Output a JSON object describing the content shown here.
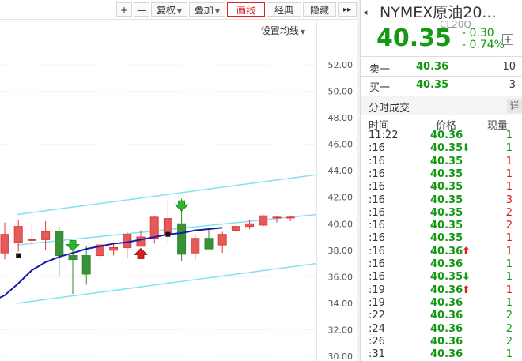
{
  "toolbar": {
    "zoom_in": "+",
    "zoom_out": "—",
    "adjust": "复权",
    "overlay": "叠加",
    "draw_line": "画线",
    "classic": "经典",
    "hide": "隐藏",
    "more": "▸▸"
  },
  "chart": {
    "ma_setting_label": "设置均线",
    "y_ticks": [
      "52.00",
      "50.00",
      "48.00",
      "46.00",
      "44.00",
      "42.00",
      "40.00",
      "38.00",
      "36.00",
      "34.00",
      "32.00",
      "30.00"
    ],
    "colors": {
      "up": "#e23a3a",
      "down": "#2e8b2e",
      "ma": "#1a1aa8",
      "channel": "#7fe3f0"
    }
  },
  "chart_data": {
    "type": "candlestick",
    "ylim": [
      30,
      52
    ],
    "y_tick_values": [
      52,
      50,
      48,
      46,
      44,
      42,
      40,
      38,
      36,
      34,
      32,
      30
    ],
    "candles": [
      {
        "o": 37.8,
        "h": 40.1,
        "l": 37.3,
        "c": 39.2
      },
      {
        "o": 38.6,
        "h": 40.3,
        "l": 37.9,
        "c": 39.8
      },
      {
        "o": 38.8,
        "h": 40.0,
        "l": 38.2,
        "c": 38.8
      },
      {
        "o": 38.8,
        "h": 40.2,
        "l": 38.0,
        "c": 39.4
      },
      {
        "o": 39.4,
        "h": 39.8,
        "l": 36.1,
        "c": 37.6
      },
      {
        "o": 37.6,
        "h": 38.1,
        "l": 34.7,
        "c": 37.3
      },
      {
        "o": 37.6,
        "h": 38.3,
        "l": 35.4,
        "c": 36.2
      },
      {
        "o": 37.6,
        "h": 39.1,
        "l": 37.2,
        "c": 38.4
      },
      {
        "o": 38.0,
        "h": 38.6,
        "l": 37.6,
        "c": 38.2
      },
      {
        "o": 38.2,
        "h": 39.4,
        "l": 37.4,
        "c": 39.2
      },
      {
        "o": 38.3,
        "h": 39.5,
        "l": 38.3,
        "c": 39.0
      },
      {
        "o": 38.9,
        "h": 40.6,
        "l": 38.5,
        "c": 40.5
      },
      {
        "o": 39.2,
        "h": 41.7,
        "l": 38.6,
        "c": 40.4
      },
      {
        "o": 40.0,
        "h": 41.9,
        "l": 37.2,
        "c": 37.7
      },
      {
        "o": 37.8,
        "h": 39.2,
        "l": 37.3,
        "c": 38.9
      },
      {
        "o": 38.9,
        "h": 39.6,
        "l": 38.1,
        "c": 38.1
      },
      {
        "o": 38.4,
        "h": 39.4,
        "l": 37.8,
        "c": 39.2
      },
      {
        "o": 39.5,
        "h": 40.0,
        "l": 39.3,
        "c": 39.8
      },
      {
        "o": 39.8,
        "h": 40.3,
        "l": 39.6,
        "c": 40.0
      },
      {
        "o": 39.9,
        "h": 40.7,
        "l": 39.8,
        "c": 40.6
      },
      {
        "o": 40.5,
        "h": 40.6,
        "l": 40.1,
        "c": 40.5
      },
      {
        "o": 40.5,
        "h": 40.6,
        "l": 40.2,
        "c": 40.5
      }
    ],
    "ma_line": [
      34.1,
      34.6,
      35.5,
      36.5,
      37.1,
      37.5,
      37.8,
      38.1,
      38.3,
      38.5,
      38.6,
      38.8,
      39.0,
      39.2,
      39.3,
      39.5,
      39.6,
      39.7
    ],
    "markers": [
      {
        "type": "buy-arrow",
        "candle": 5,
        "value": 38.2,
        "color": "#2ab72a"
      },
      {
        "type": "sell-arrow",
        "candle": 10,
        "value": 37.9,
        "color": "#d62020"
      },
      {
        "type": "buy-arrow",
        "candle": 13,
        "value": 41.2,
        "color": "#2ab72a"
      },
      {
        "type": "dot",
        "candle": 1,
        "value": 37.6,
        "color": "#111111"
      },
      {
        "type": "dot",
        "candle": 12,
        "value": 39.2,
        "color": "#111111"
      }
    ]
  },
  "quote": {
    "collapse_icon": "◂",
    "symbol": "NYMEX原油20...",
    "code": "CL20Q",
    "last_price": "40.35",
    "change": "- 0.30",
    "change_pct": "- 0.74%",
    "add_button": "+",
    "sell1": {
      "label": "卖一",
      "price": "40.36",
      "vol": "10"
    },
    "buy1": {
      "label": "买一",
      "price": "40.35",
      "vol": "3"
    },
    "trades_title": "分时成交",
    "detail_label": "详",
    "col_time": "时间",
    "col_price": "价格",
    "col_vol": "现量",
    "trades": [
      {
        "time": "11:22",
        "price": "40.36",
        "arrow": "",
        "vol": "1",
        "vol_color": "#159915"
      },
      {
        "time": ":16",
        "price": "40.35",
        "arrow": "⬇",
        "arrow_color": "#159915",
        "vol": "1",
        "vol_color": "#159915"
      },
      {
        "time": ":16",
        "price": "40.35",
        "arrow": "",
        "vol": "1",
        "vol_color": "#d62020"
      },
      {
        "time": ":16",
        "price": "40.35",
        "arrow": "",
        "vol": "1",
        "vol_color": "#d62020"
      },
      {
        "time": ":16",
        "price": "40.35",
        "arrow": "",
        "vol": "1",
        "vol_color": "#d62020"
      },
      {
        "time": ":16",
        "price": "40.35",
        "arrow": "",
        "vol": "3",
        "vol_color": "#d62020"
      },
      {
        "time": ":16",
        "price": "40.35",
        "arrow": "",
        "vol": "2",
        "vol_color": "#d62020"
      },
      {
        "time": ":16",
        "price": "40.35",
        "arrow": "",
        "vol": "2",
        "vol_color": "#d62020"
      },
      {
        "time": ":16",
        "price": "40.35",
        "arrow": "",
        "vol": "1",
        "vol_color": "#d62020"
      },
      {
        "time": ":16",
        "price": "40.36",
        "arrow": "⬆",
        "arrow_color": "#d62020",
        "vol": "1",
        "vol_color": "#d62020"
      },
      {
        "time": ":16",
        "price": "40.36",
        "arrow": "",
        "vol": "1",
        "vol_color": "#159915"
      },
      {
        "time": ":16",
        "price": "40.35",
        "arrow": "⬇",
        "arrow_color": "#159915",
        "vol": "1",
        "vol_color": "#159915"
      },
      {
        "time": ":19",
        "price": "40.36",
        "arrow": "⬆",
        "arrow_color": "#d62020",
        "vol": "1",
        "vol_color": "#d62020"
      },
      {
        "time": ":19",
        "price": "40.36",
        "arrow": "",
        "vol": "1",
        "vol_color": "#159915"
      },
      {
        "time": ":22",
        "price": "40.36",
        "arrow": "",
        "vol": "2",
        "vol_color": "#159915"
      },
      {
        "time": ":24",
        "price": "40.36",
        "arrow": "",
        "vol": "2",
        "vol_color": "#159915"
      },
      {
        "time": ":26",
        "price": "40.36",
        "arrow": "",
        "vol": "2",
        "vol_color": "#159915"
      },
      {
        "time": ":31",
        "price": "40.36",
        "arrow": "",
        "vol": "1",
        "vol_color": "#159915"
      }
    ]
  }
}
